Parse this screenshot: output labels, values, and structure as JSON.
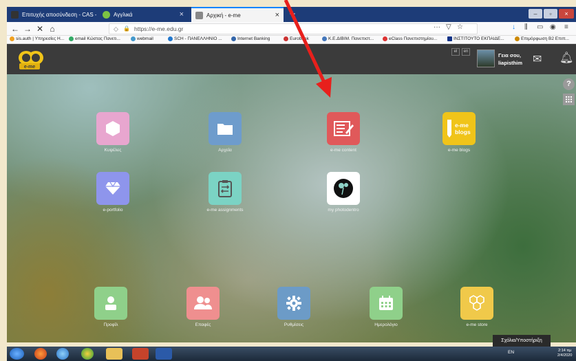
{
  "browser": {
    "tabs": [
      {
        "label": "Επιτυχής αποσύνδεση - CAS -",
        "icon": "cas-icon"
      },
      {
        "label": "Αγγλικά",
        "icon": "parrot-icon"
      },
      {
        "label": "Αρχική - e-me",
        "icon": "eme-icon"
      }
    ],
    "new_tab": "+",
    "url": "https://e-me.edu.gr",
    "bookmarks": [
      "sis.auth | Υπηρεσίες Η...",
      "email Κώστας Πανετι...",
      "webmail",
      "SCH - ΠΑΝΕΛΛΗΝΙΟ ...",
      "Internet Banking",
      "Eurobank",
      "Κ.Ε.ΔΙΒΙΜ. Πανεπιστ...",
      "eClass Πανεπιστημίου...",
      "ΙΝΣΤΙΤΟΥΤΟ ΕΚΠΑΙΔΕ...",
      "Επιμόρφωση Β2 Επιπ..."
    ]
  },
  "header": {
    "logo_text": "e-me",
    "languages": [
      "el",
      "en"
    ],
    "greeting_line1": "Γεια σου,",
    "greeting_line2": "liapisthim"
  },
  "apps": [
    {
      "label": "Κυψέλες",
      "icon": "hexagon-icon",
      "color": "#e8a6cf"
    },
    {
      "label": "Αρχεία",
      "icon": "folder-icon",
      "color": "#6e9ccc"
    },
    {
      "label": "e-me content",
      "icon": "content-edit-icon",
      "color": "#e0595a"
    },
    {
      "label": "e-me blogs",
      "icon": "blogs-icon",
      "color": "#f0c419"
    },
    {
      "label": "e-portfolio",
      "icon": "diamond-icon",
      "color": "#8e95ec"
    },
    {
      "label": "e-me assignments",
      "icon": "assignment-icon",
      "color": "#7bd3c4"
    },
    {
      "label": "my photodentro",
      "icon": "photodentro-icon",
      "color": "#ffffff"
    }
  ],
  "dock": [
    {
      "label": "Προφίλ",
      "icon": "person-icon",
      "color": "#8fd08a"
    },
    {
      "label": "Επαφές",
      "icon": "contacts-icon",
      "color": "#ef8f8f"
    },
    {
      "label": "Ρυθμίσεις",
      "icon": "gear-icon",
      "color": "#6c9bc7"
    },
    {
      "label": "Ημερολόγιο",
      "icon": "calendar-icon",
      "color": "#8fd08a"
    },
    {
      "label": "e-me store",
      "icon": "store-icon",
      "color": "#f0c94a"
    }
  ],
  "blogs_tile_text": "e-me blogs",
  "support_label": "Σχόλια/Υποστήριξη",
  "taskbar": {
    "lang": "EN",
    "time": "2:14 πμ",
    "date": "2/4/2020"
  },
  "colors": {
    "header": "#3b3b3b",
    "arrow": "#e8201c",
    "tabstrip": "#1d3c78"
  }
}
